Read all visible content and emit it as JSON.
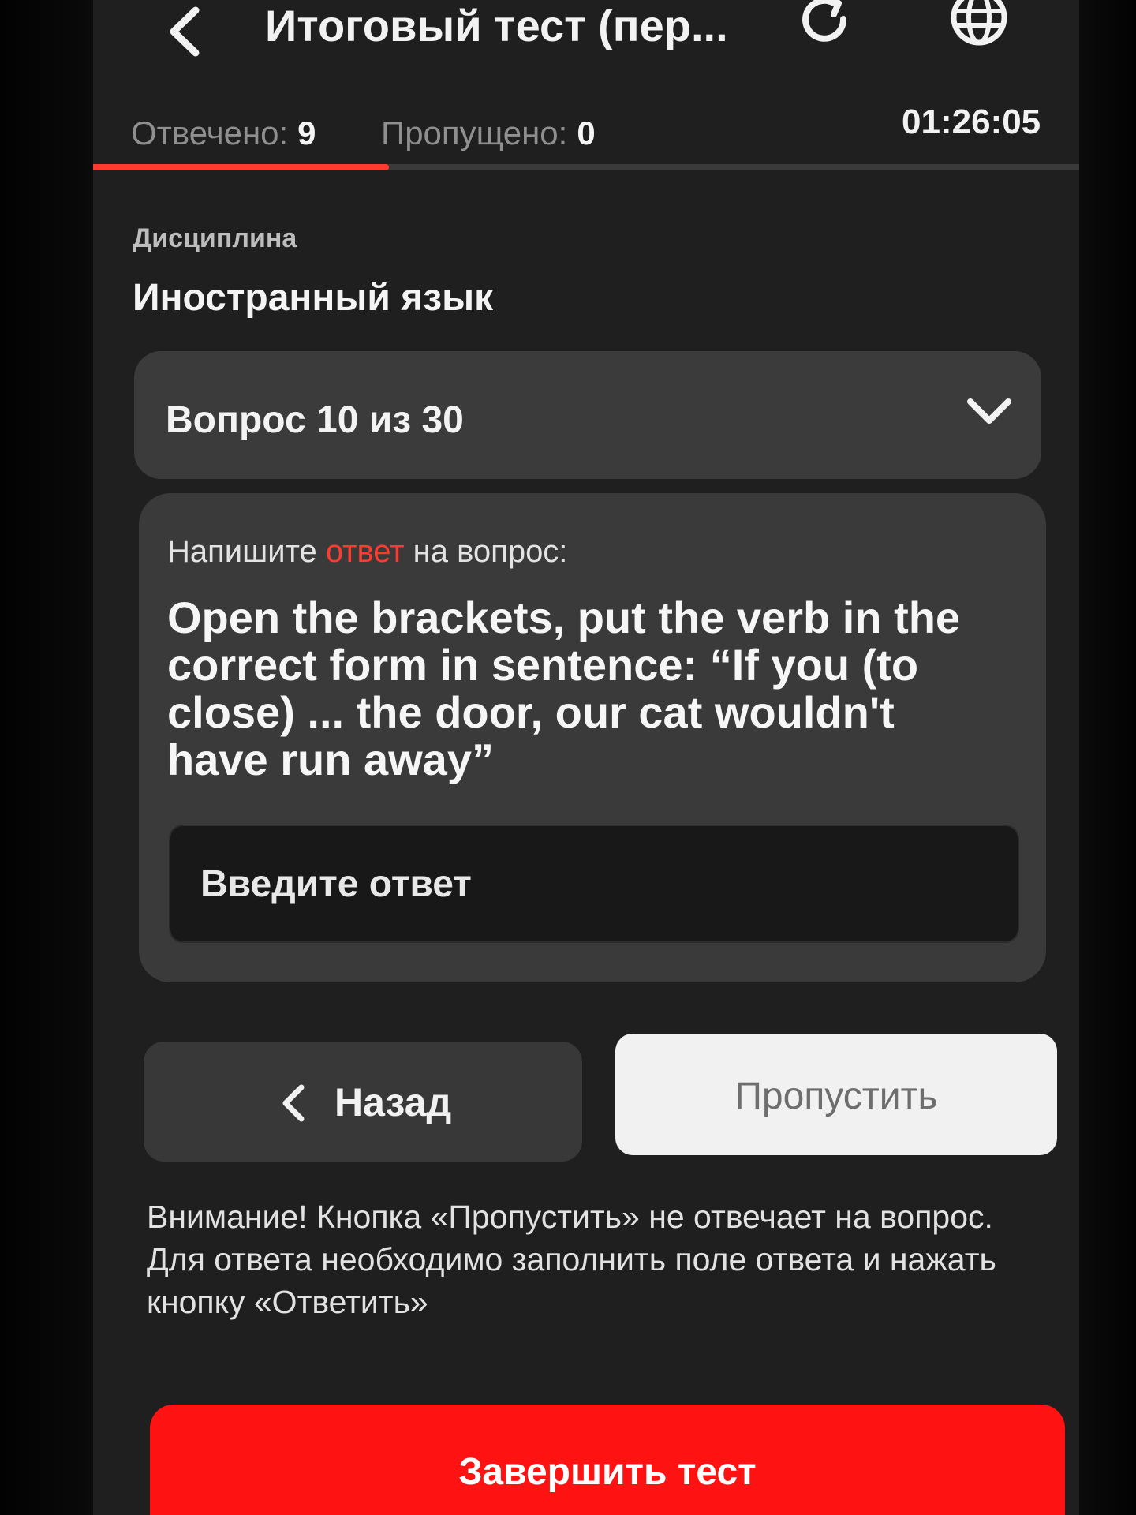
{
  "header": {
    "title": "Итоговый тест (пер..."
  },
  "stats": {
    "answered_label": "Отвечено:",
    "answered_count": "9",
    "skipped_label": "Пропущено:",
    "skipped_count": "0",
    "timer": "01:26:05",
    "progress_fraction": 0.3
  },
  "discipline": {
    "label": "Дисциплина",
    "value": "Иностранный язык"
  },
  "question_selector": {
    "label": "Вопрос 10 из 30"
  },
  "question": {
    "instruction_before": "Напишите ",
    "instruction_accent": "ответ",
    "instruction_after": " на вопрос:",
    "text": "Open the brackets, put the verb in the correct form in sentence: “If you (to close) ... the door, our cat wouldn't have run away”",
    "answer_placeholder": "Введите ответ"
  },
  "buttons": {
    "back_label": "Назад",
    "skip_label": "Пропустить",
    "finish_label": "Завершить тест"
  },
  "warning": "Внимание! Кнопка «Пропустить» не отвечает на вопрос. Для ответа необходимо заполнить поле ответа и нажать кнопку «Ответить»",
  "colors": {
    "accent": "#ff3b2f",
    "finish_button": "#ff1212",
    "background": "#1f1f1f",
    "card": "#3a3a3a"
  }
}
